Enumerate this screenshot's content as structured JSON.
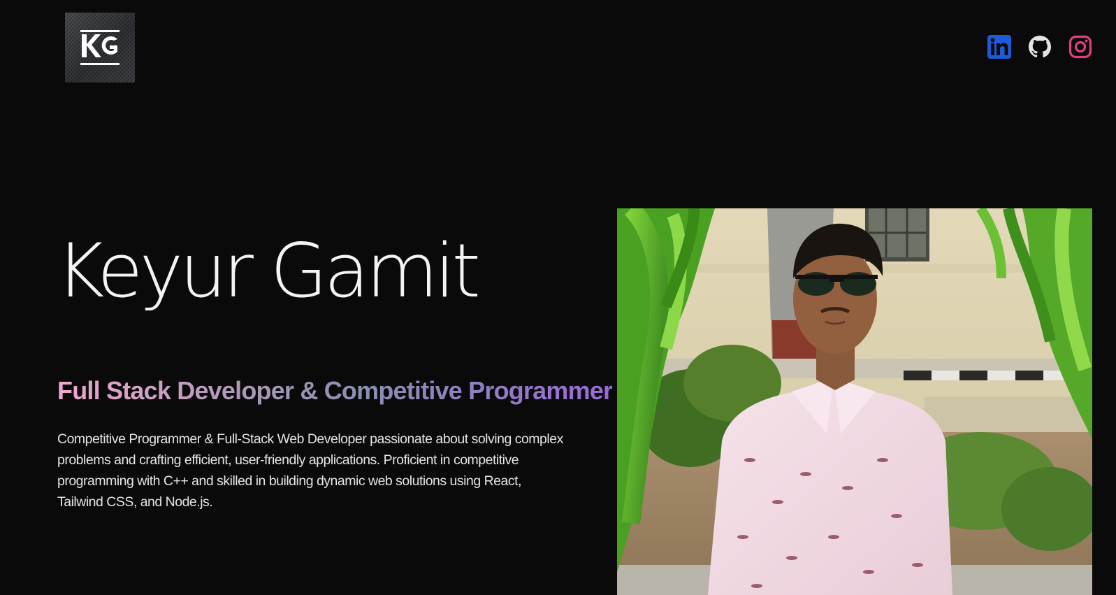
{
  "header": {
    "logo_text": "KG",
    "social": [
      {
        "name": "linkedin-icon",
        "color": "#1d5bd8"
      },
      {
        "name": "github-icon",
        "color": "#e5e5e5"
      },
      {
        "name": "instagram-icon",
        "color": "#e1407f"
      }
    ]
  },
  "hero": {
    "name": "Keyur Gamit",
    "role": "Full Stack Developer & Competitive Programmer",
    "bio": "Competitive Programmer & Full-Stack Web Developer passionate about solving complex problems and crafting efficient, user-friendly applications. Proficient in competitive programming with C++ and skilled in building dynamic web solutions using React, Tailwind CSS, and Node.js."
  },
  "colors": {
    "background": "#0a0a0b",
    "role_gradient": [
      "#f0a8d0",
      "#8a8fb0",
      "#9b6ad9"
    ]
  }
}
